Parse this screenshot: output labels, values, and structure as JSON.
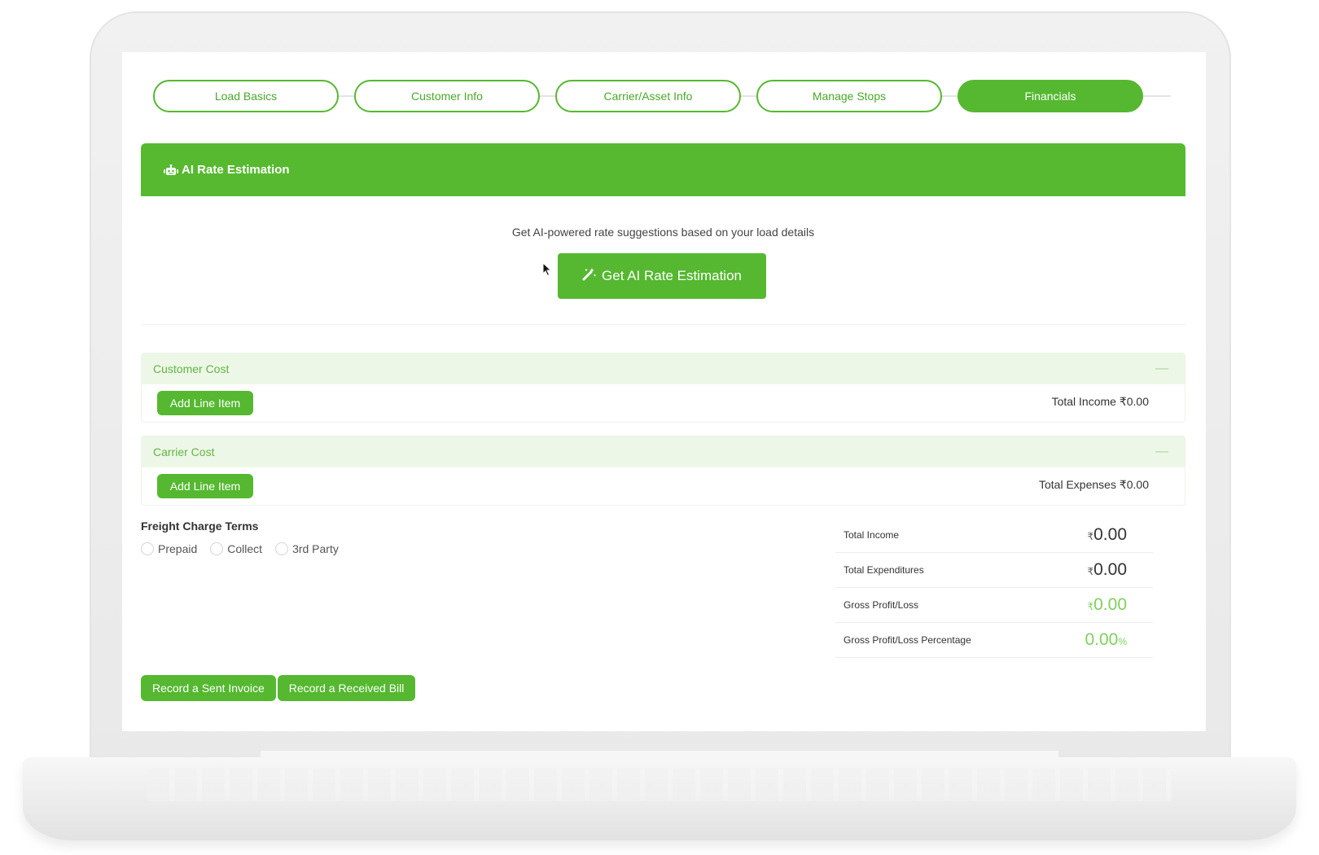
{
  "stepper": {
    "steps": [
      {
        "label": "Load Basics",
        "active": false
      },
      {
        "label": "Customer Info",
        "active": false
      },
      {
        "label": "Carrier/Asset Info",
        "active": false
      },
      {
        "label": "Manage Stops",
        "active": false
      },
      {
        "label": "Financials",
        "active": true
      }
    ]
  },
  "ai_estimation": {
    "title": "AI Rate Estimation",
    "description": "Get AI-powered rate suggestions based on your load details",
    "button_label": "Get AI Rate Estimation",
    "header_icon": "robot-icon",
    "button_icon": "magic-wand-icon"
  },
  "customer_cost": {
    "title": "Customer Cost",
    "collapse_symbol": "—",
    "add_button": "Add Line Item",
    "total_label": "Total Income ₹0.00"
  },
  "carrier_cost": {
    "title": "Carrier Cost",
    "collapse_symbol": "—",
    "add_button": "Add Line Item",
    "total_label": "Total Expenses ₹0.00"
  },
  "freight_terms": {
    "title": "Freight Charge Terms",
    "options": [
      "Prepaid",
      "Collect",
      "3rd Party"
    ]
  },
  "summary": {
    "rows": [
      {
        "label": "Total Income",
        "currency": "₹",
        "value": "0.00",
        "suffix": "",
        "highlight": false
      },
      {
        "label": "Total Expenditures",
        "currency": "₹",
        "value": "0.00",
        "suffix": "",
        "highlight": false
      },
      {
        "label": "Gross Profit/Loss",
        "currency": "₹",
        "value": "0.00",
        "suffix": "",
        "highlight": true
      },
      {
        "label": "Gross Profit/Loss Percentage",
        "currency": "",
        "value": "0.00",
        "suffix": "%",
        "highlight": true
      }
    ]
  },
  "actions": {
    "record_sent_invoice": "Record a Sent Invoice",
    "record_received_bill": "Record a Received Bill"
  },
  "colors": {
    "brand_green": "#55b830",
    "light_green_bg": "#edf7e7",
    "value_green": "#7ed05b"
  }
}
